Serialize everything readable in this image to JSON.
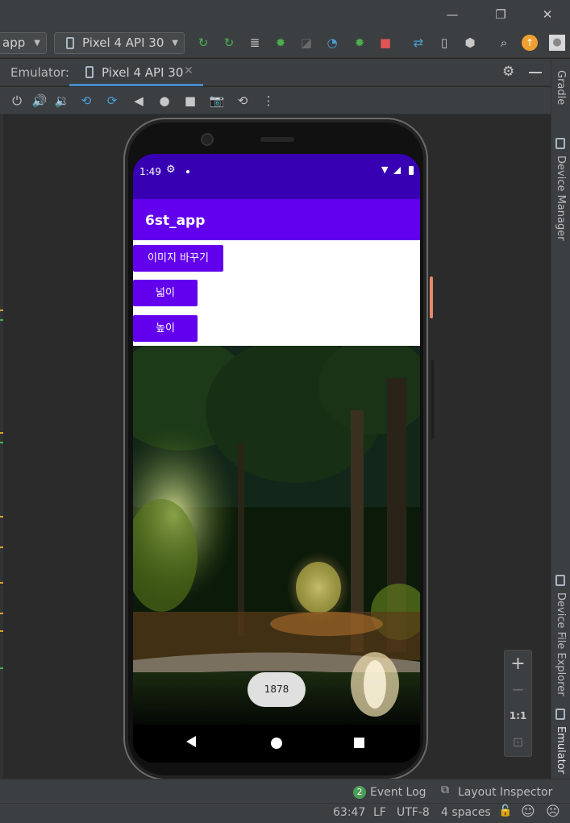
{
  "window": {
    "minimize": "—",
    "restore": "❐",
    "close": "✕"
  },
  "toolbar": {
    "app_config": "app",
    "device": "Pixel 4 API 30",
    "icons": [
      "apply-changes-icon",
      "apply-code-changes-icon",
      "logcat-icon",
      "debug-icon",
      "attach-debugger-icon",
      "profile-icon",
      "run-coverage-icon",
      "stop-icon",
      "sync-gradle-icon",
      "device-manager-icon",
      "sdk-manager-icon",
      "search-icon",
      "update-icon",
      "avatar-icon"
    ]
  },
  "emulator_panel": {
    "label": "Emulator:",
    "tab": "Pixel 4 API 30",
    "tab_close": "✕",
    "controls": [
      "power-icon",
      "volume-up-icon",
      "volume-down-icon",
      "rotate-left-icon",
      "rotate-right-icon",
      "back-icon",
      "home-icon",
      "overview-icon",
      "screenshot-icon",
      "snapshot-icon",
      "more-icon"
    ]
  },
  "side_tools": {
    "gradle": "Gradle",
    "device_manager": "Device Manager",
    "device_file_explorer": "Device File Explorer",
    "emulator": "Emulator"
  },
  "device_screen": {
    "status_time": "1:49",
    "app_title": "6st_app",
    "buttons": [
      "이미지 바꾸기",
      "넓이",
      "높이"
    ],
    "toast": "1878"
  },
  "zoom": {
    "in": "+",
    "out": "−",
    "actual": "1:1",
    "fit": "⊡"
  },
  "bottom": {
    "event_log_count": "2",
    "event_log": "Event Log",
    "layout_inspector": "Layout Inspector",
    "position": "63:47",
    "line_sep": "LF",
    "encoding": "UTF-8",
    "indent": "4 spaces"
  },
  "colors": {
    "status_bar": "#3700b3",
    "app_bar": "#6200ee",
    "button": "#6200ee",
    "ide_bg": "#3c3f41",
    "tab_underline": "#4a88c7"
  }
}
